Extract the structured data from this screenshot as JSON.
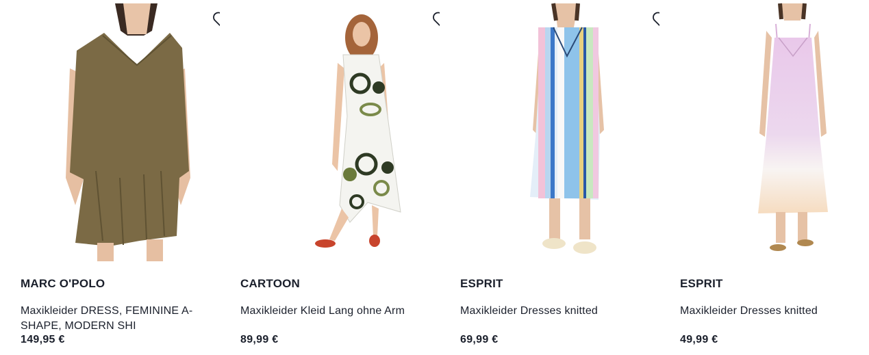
{
  "products": [
    {
      "brand": "MARC O'POLO",
      "title": "Maxikleider DRESS, FEMININE A-SHAPE, MODERN SHI",
      "price": "149,95 €",
      "favorite_icon": "heart-outline-icon",
      "dress_color": "#7b6a45"
    },
    {
      "brand": "CARTOON",
      "title": "Maxikleider Kleid Lang ohne Arm",
      "price": "89,99 €",
      "favorite_icon": "heart-outline-icon",
      "dress_color": "#f4f4f0"
    },
    {
      "brand": "ESPRIT",
      "title": "Maxikleider Dresses knitted",
      "price": "69,99 €",
      "favorite_icon": "heart-outline-icon",
      "dress_color": "#8ec3ea"
    },
    {
      "brand": "ESPRIT",
      "title": "Maxikleider Dresses knitted",
      "price": "49,99 €",
      "favorite_icon": "heart-outline-icon",
      "dress_color": "#e9c8ea"
    }
  ]
}
